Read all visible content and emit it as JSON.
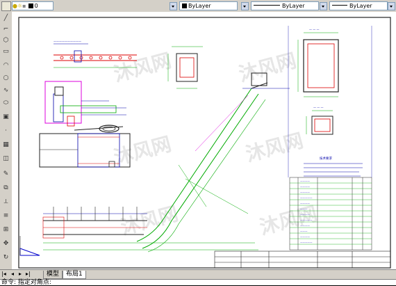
{
  "toolbar": {
    "layer_number": "0",
    "color_combo": "ByLayer",
    "linetype_combo": "ByLayer",
    "lineweight_combo": "ByLayer"
  },
  "tabs": {
    "model": "模型",
    "layout": "布局1"
  },
  "command": {
    "prompt": "命令: 指定对角点:"
  },
  "drawing": {
    "watermark": "沐风网",
    "tech_title": "技术要求"
  }
}
